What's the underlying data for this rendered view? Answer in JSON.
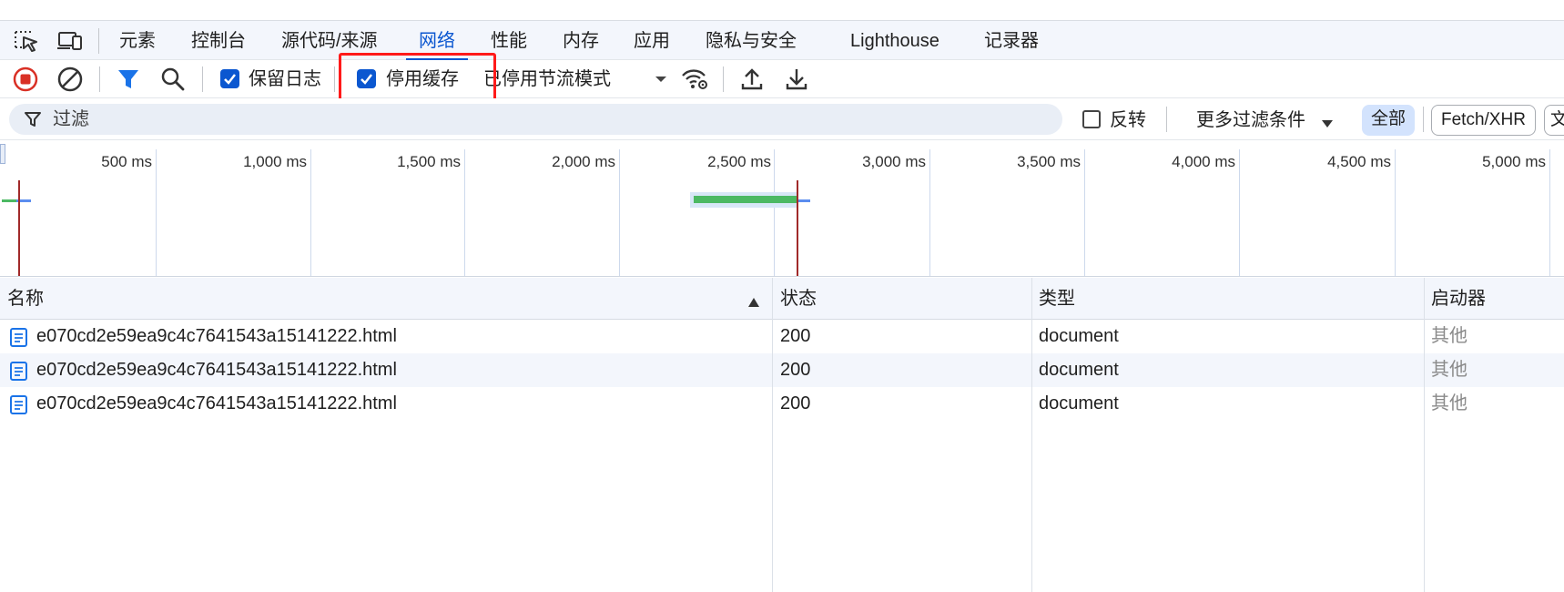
{
  "devtools": {
    "tabs": [
      {
        "label": "元素"
      },
      {
        "label": "控制台"
      },
      {
        "label": "源代码/来源"
      },
      {
        "label": "网络"
      },
      {
        "label": "性能"
      },
      {
        "label": "内存"
      },
      {
        "label": "应用"
      },
      {
        "label": "隐私与安全"
      },
      {
        "label": "Lighthouse"
      },
      {
        "label": "记录器"
      }
    ],
    "active_tab": "网络"
  },
  "toolbar": {
    "preserve_log_label": "保留日志",
    "preserve_log_checked": true,
    "disable_cache_label": "停用缓存",
    "disable_cache_checked": true,
    "throttling_value": "已停用节流模式"
  },
  "filter": {
    "placeholder": "过滤",
    "invert_label": "反转",
    "invert_checked": false,
    "more_filters_label": "更多过滤条件",
    "type_chips": [
      "全部",
      "Fetch/XHR",
      "文"
    ]
  },
  "overview": {
    "ticks": [
      "500 ms",
      "1,000 ms",
      "1,500 ms",
      "2,000 ms",
      "2,500 ms",
      "3,000 ms",
      "3,500 ms",
      "4,000 ms",
      "4,500 ms",
      "5,000 ms"
    ]
  },
  "table": {
    "columns": {
      "name": "名称",
      "status": "状态",
      "type": "类型",
      "initiator": "启动器"
    },
    "rows": [
      {
        "name": "e070cd2e59ea9c4c7641543a15141222.html",
        "status": "200",
        "type": "document",
        "initiator": "其他"
      },
      {
        "name": "e070cd2e59ea9c4c7641543a15141222.html",
        "status": "200",
        "type": "document",
        "initiator": "其他"
      },
      {
        "name": "e070cd2e59ea9c4c7641543a15141222.html",
        "status": "200",
        "type": "document",
        "initiator": "其他"
      }
    ]
  },
  "colors": {
    "accent": "#0b57d0",
    "record_red": "#d93025",
    "highlight_red": "#ff1a1a",
    "waterfall_green": "#4cb963",
    "waterfall_blue": "#5b8def"
  }
}
